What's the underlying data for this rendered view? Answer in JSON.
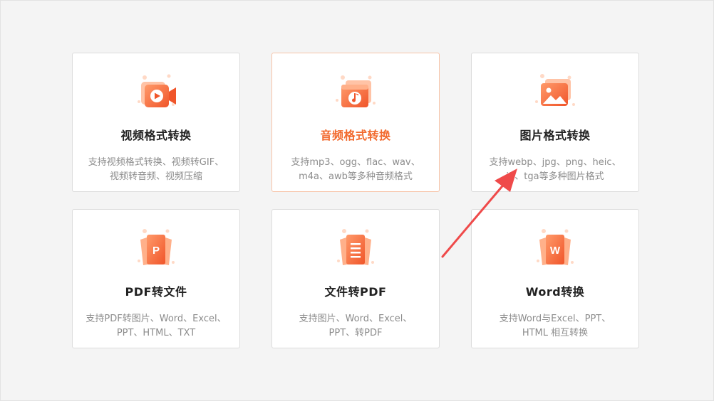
{
  "colors": {
    "accent": "#f26a2e",
    "accent_light": "#ffb08a",
    "arrow": "#ef4a4a"
  },
  "cards": [
    {
      "title": "视频格式转换",
      "desc": [
        "支持视频格式转换、视频转GIF、",
        "视频转音频、视频压缩"
      ],
      "icon": "video-camera-icon"
    },
    {
      "title": "音频格式转换",
      "desc": [
        "支持mp3、ogg、flac、wav、",
        "m4a、awb等多种音频格式"
      ],
      "icon": "music-note-icon",
      "active": true
    },
    {
      "title": "图片格式转换",
      "desc": [
        "支持webp、jpg、png、heic、",
        "j2、tga等多种图片格式"
      ],
      "icon": "image-icon"
    },
    {
      "title": "PDF转文件",
      "desc": [
        "支持PDF转图片、Word、Excel、",
        "PPT、HTML、TXT"
      ],
      "icon": "ppt-file-icon"
    },
    {
      "title": "文件转PDF",
      "desc": [
        "支持图片、Word、Excel、",
        "PPT、转PDF"
      ],
      "icon": "document-list-icon"
    },
    {
      "title": "Word转换",
      "desc": [
        "支持Word与Excel、PPT、",
        "HTML 相互转换"
      ],
      "icon": "word-file-icon"
    }
  ],
  "icon_letters": {
    "ppt": "P",
    "word": "W"
  }
}
